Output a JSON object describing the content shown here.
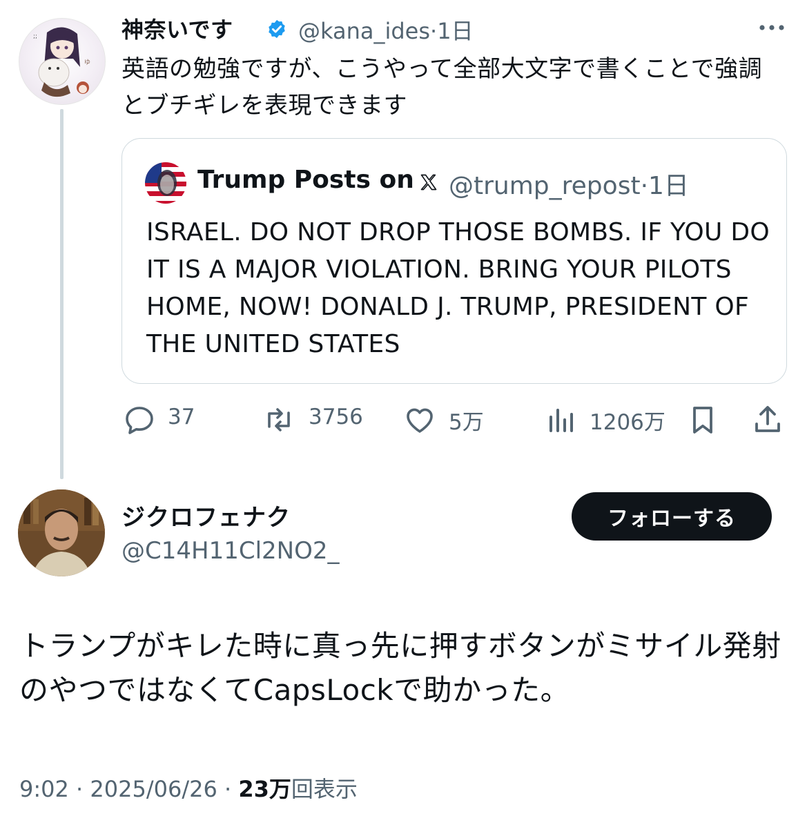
{
  "parent_tweet": {
    "display_name": "神奈いです",
    "handle": "@kana_ides",
    "separator": "·",
    "time": "1日",
    "text": "英語の勉強ですが、こうやって全部大文字で書くことで強調とブチギレを表現できます",
    "quoted": {
      "display_name": "Trump Posts on",
      "handle": "@trump_repost",
      "separator": "·",
      "time": "1日",
      "text": "ISRAEL. DO NOT DROP THOSE BOMBS. IF YOU DO IT IS A MAJOR VIOLATION. BRING YOUR PILOTS HOME, NOW! DONALD J. TRUMP, PRESIDENT OF THE UNITED STATES"
    },
    "actions": {
      "replies": "37",
      "retweets": "3756",
      "likes": "5万",
      "views": "1206万"
    }
  },
  "reply_tweet": {
    "display_name": "ジクロフェナク",
    "handle": "@C14H11Cl2NO2_",
    "follow_label": "フォローする",
    "text": "トランプがキレた時に真っ先に押すボタンがミサイル発射のやつではなくてCapsLockで助かった。",
    "meta": {
      "time": "9:02",
      "separator1": "·",
      "date": "2025/06/26",
      "separator2": "·",
      "view_count": "23万",
      "view_suffix": "回表示"
    }
  },
  "colors": {
    "text": "#0f1419",
    "muted": "#536471",
    "verified": "#1d9bf0",
    "border": "#cfd9de",
    "follow_bg": "#0f1419"
  },
  "icons": [
    "verified-badge-icon",
    "more-icon",
    "x-logo-icon",
    "reply-icon",
    "retweet-icon",
    "like-icon",
    "views-icon",
    "bookmark-icon",
    "share-icon"
  ]
}
